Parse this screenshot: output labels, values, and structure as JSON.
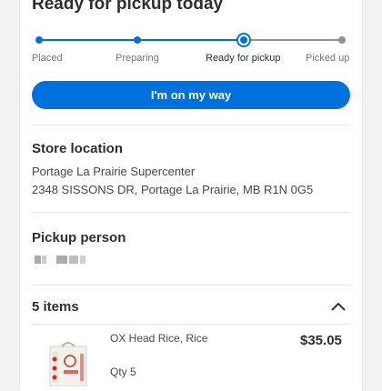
{
  "header": {
    "title": "Ready for pickup today"
  },
  "progress": {
    "steps": [
      {
        "label": "Placed"
      },
      {
        "label": "Preparing"
      },
      {
        "label": "Ready for pickup"
      },
      {
        "label": "Picked up"
      }
    ],
    "current_step": 3,
    "colors": {
      "done": "#0071dc",
      "pending": "#909196"
    }
  },
  "actions": {
    "on_my_way_label": "I'm on my way"
  },
  "store": {
    "heading": "Store location",
    "name": "Portage La Prairie Supercenter",
    "address": "2348 SISSONS DR, Portage La Prairie, MB R1N 0G5"
  },
  "pickup_person": {
    "heading": "Pickup person"
  },
  "items": {
    "count_label": "5 items",
    "list": [
      {
        "name": "OX Head Rice, Rice",
        "qty_label": "Qty 5",
        "price": "$35.05"
      }
    ]
  },
  "icons": {
    "collapse": "chevron-up-icon",
    "product": "rice-bag-image"
  }
}
